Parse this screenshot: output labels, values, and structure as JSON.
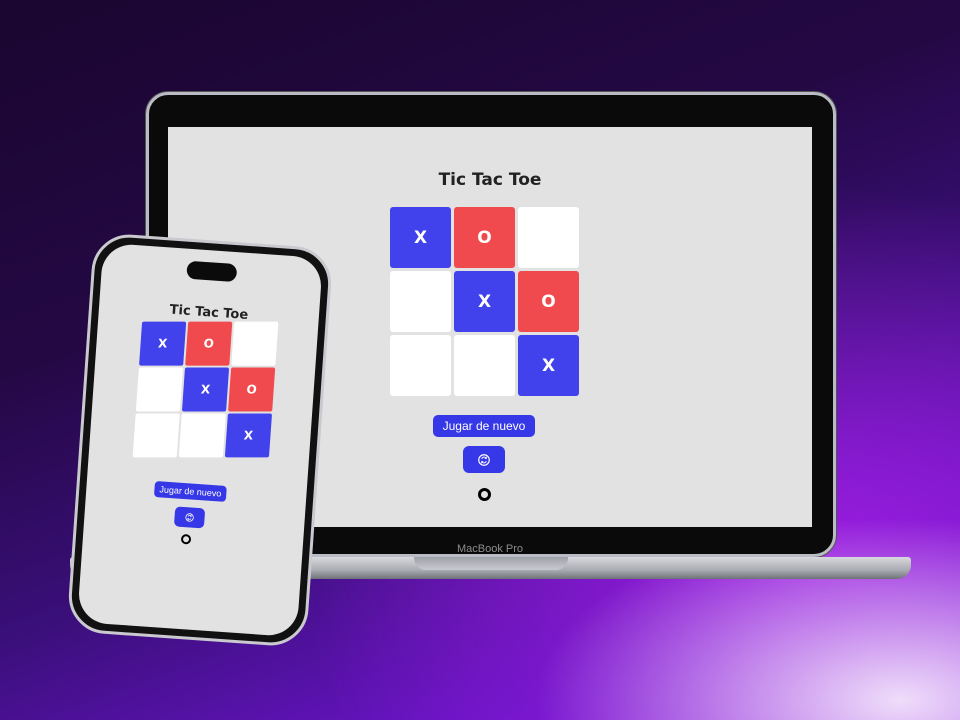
{
  "device_label": "MacBook Pro",
  "game": {
    "title": "Tic Tac Toe",
    "board": [
      {
        "mark": "X",
        "state": "x"
      },
      {
        "mark": "O",
        "state": "o"
      },
      {
        "mark": "",
        "state": "empty"
      },
      {
        "mark": "",
        "state": "empty"
      },
      {
        "mark": "X",
        "state": "x"
      },
      {
        "mark": "O",
        "state": "o"
      },
      {
        "mark": "",
        "state": "empty"
      },
      {
        "mark": "",
        "state": "empty"
      },
      {
        "mark": "X",
        "state": "x"
      }
    ],
    "replay_label": "Jugar de nuevo",
    "reset_icon": "refresh-icon",
    "status_symbol": "O"
  },
  "colors": {
    "x_cell": "#4142ec",
    "o_cell": "#f04a4e",
    "empty_cell": "#ffffff",
    "button": "#3638e8",
    "screen_bg": "#e2e2e2"
  }
}
